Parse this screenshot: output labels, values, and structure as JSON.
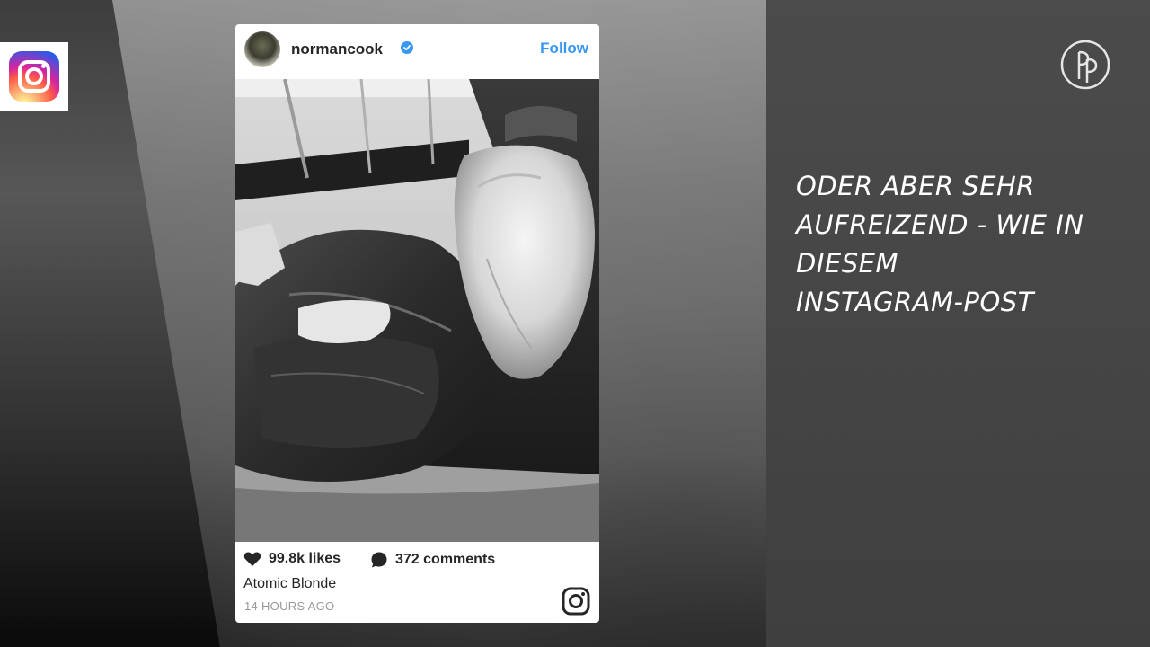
{
  "post": {
    "username": "normancook",
    "follow_label": "Follow",
    "likes": "99.8k likes",
    "comments": "372 comments",
    "caption": "Atomic Blonde",
    "time": "14 HOURS AGO"
  },
  "headline": {
    "lines": [
      "ODER ABER SEHR",
      "AUFREIZEND - WIE IN",
      "DIESEM",
      "INSTAGRAM-POST"
    ]
  },
  "icons": {
    "badge": "instagram-logo-icon",
    "verified": "verified-badge-icon",
    "heart": "heart-icon",
    "comment": "comment-bubble-icon",
    "glyph": "instagram-glyph-icon",
    "brand": "brand-logo-icon"
  },
  "colors": {
    "follow": "#3897f0",
    "verified": "#3897f0",
    "timestamp": "#999999",
    "headline": "#ffffff"
  }
}
